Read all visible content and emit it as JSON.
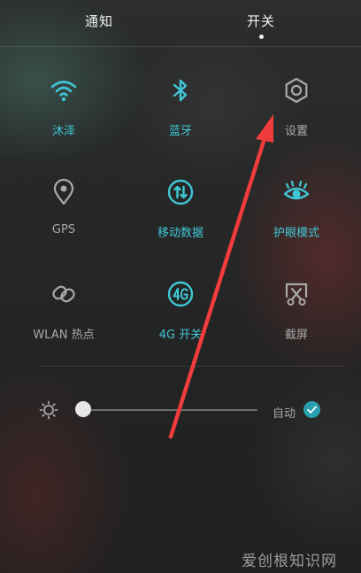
{
  "tabs": {
    "notify": "通知",
    "switch": "开关"
  },
  "tiles": [
    {
      "label": "沐泽",
      "icon": "wifi-icon",
      "state": "on"
    },
    {
      "label": "蓝牙",
      "icon": "bluetooth-icon",
      "state": "on"
    },
    {
      "label": "设置",
      "icon": "gear-icon",
      "state": "off"
    },
    {
      "label": "GPS",
      "icon": "location-pin-icon",
      "state": "off"
    },
    {
      "label": "移动数据",
      "icon": "mobile-data-icon",
      "state": "on"
    },
    {
      "label": "护眼模式",
      "icon": "eye-icon",
      "state": "on"
    },
    {
      "label": "WLAN 热点",
      "icon": "hotspot-icon",
      "state": "off"
    },
    {
      "label": "4G 开关",
      "icon": "4g-icon",
      "state": "on"
    },
    {
      "label": "截屏",
      "icon": "screenshot-icon",
      "state": "off"
    }
  ],
  "brightness": {
    "level": 0.04,
    "auto_label": "自动",
    "auto_checked": true
  },
  "colors": {
    "active": "#3fc8d6",
    "inactive": "#a9a9a9",
    "annotation_arrow": "#f03c3c"
  },
  "watermark": "爱创根知识网"
}
